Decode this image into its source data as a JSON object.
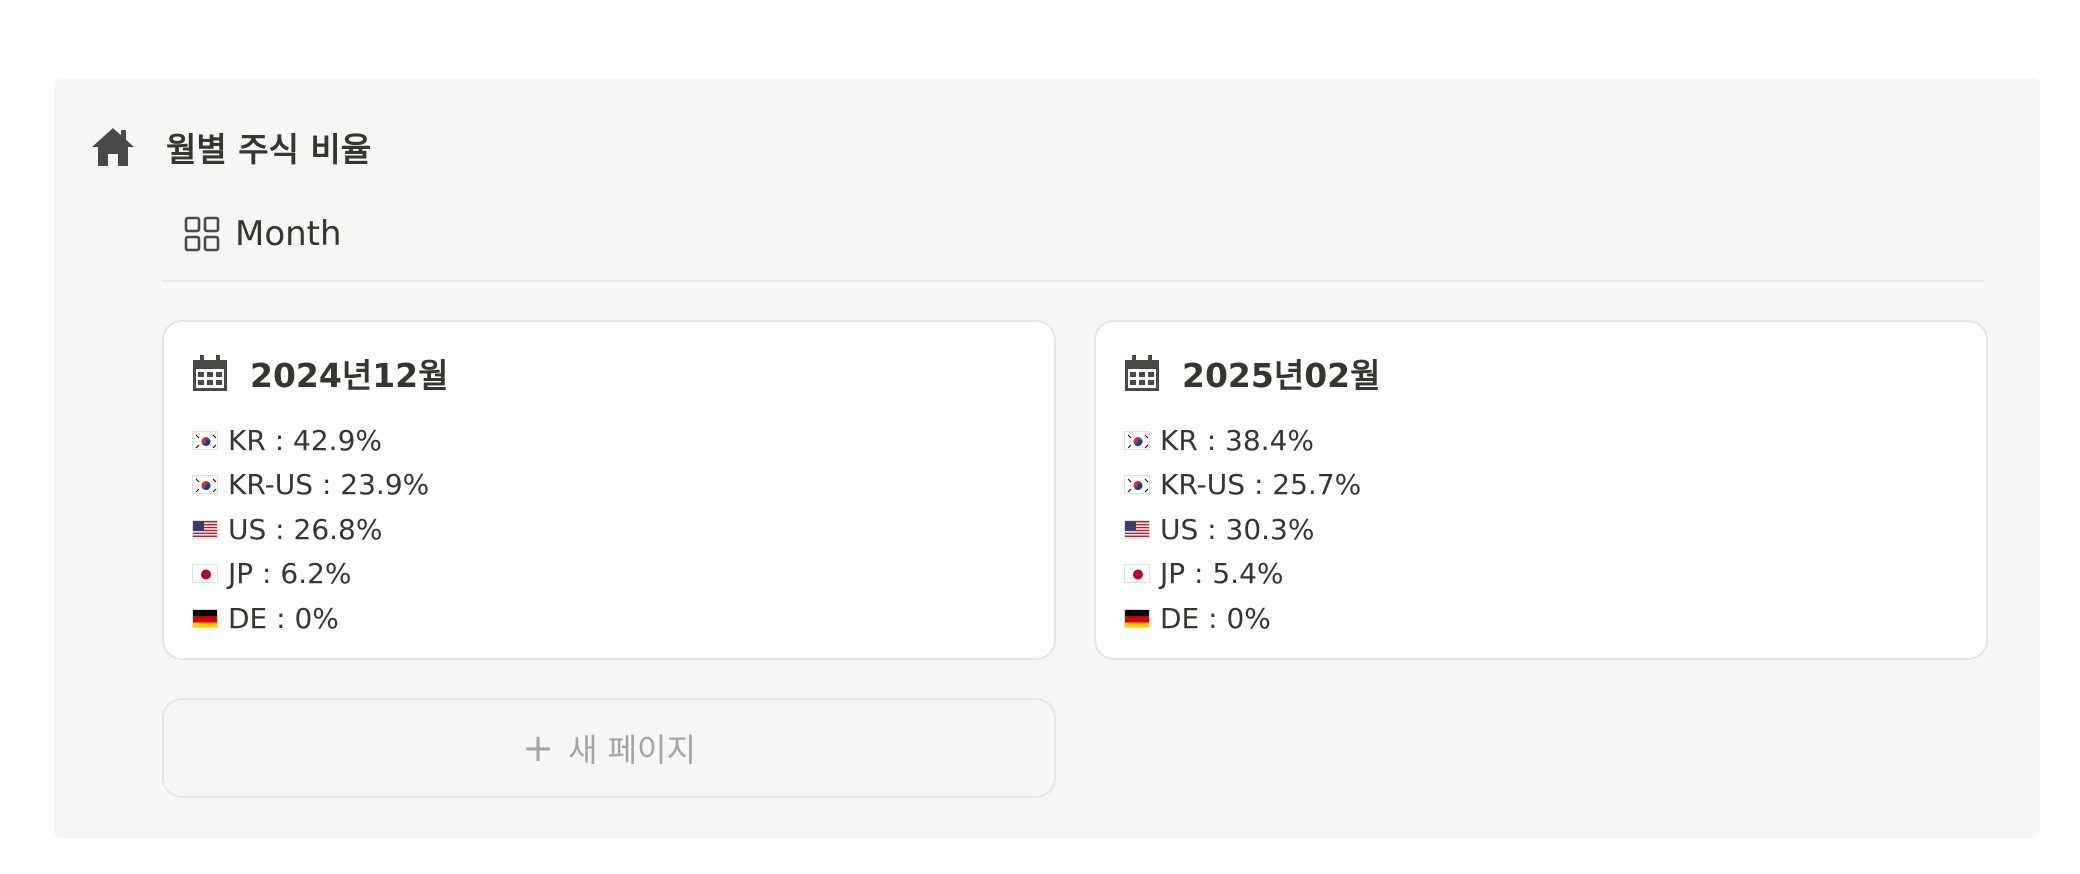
{
  "block": {
    "icon": "home-icon",
    "title": "월별 주식 비율"
  },
  "view": {
    "icon": "grid-icon",
    "label": "Month"
  },
  "cards": [
    {
      "icon": "calendar-icon",
      "title": "2024년12월",
      "rows": [
        {
          "flag": "KR",
          "text": "KR : 42.9%"
        },
        {
          "flag": "KR",
          "text": "KR-US : 23.9%"
        },
        {
          "flag": "US",
          "text": "US : 26.8%"
        },
        {
          "flag": "JP",
          "text": "JP : 6.2%"
        },
        {
          "flag": "DE",
          "text": "DE : 0%"
        }
      ]
    },
    {
      "icon": "calendar-icon",
      "title": "2025년02월",
      "rows": [
        {
          "flag": "KR",
          "text": "KR : 38.4%"
        },
        {
          "flag": "KR",
          "text": "KR-US : 25.7%"
        },
        {
          "flag": "US",
          "text": "US : 30.3%"
        },
        {
          "flag": "JP",
          "text": "JP : 5.4%"
        },
        {
          "flag": "DE",
          "text": "DE : 0%"
        }
      ]
    }
  ],
  "new_page": {
    "icon": "plus-icon",
    "label": "새 페이지"
  },
  "colors": {
    "block_bg": "#f6f6f4",
    "text": "#37352f",
    "muted": "#a5a4a0"
  }
}
